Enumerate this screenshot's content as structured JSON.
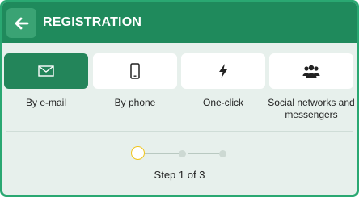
{
  "header": {
    "title": "REGISTRATION",
    "back_icon": "arrow-left-icon",
    "color": "#1f8a5c"
  },
  "tabs": [
    {
      "id": "email",
      "label": "By e-mail",
      "icon": "envelope-icon",
      "active": true
    },
    {
      "id": "phone",
      "label": "By phone",
      "icon": "smartphone-icon",
      "active": false
    },
    {
      "id": "oneclick",
      "label": "One-click",
      "icon": "lightning-icon",
      "active": false
    },
    {
      "id": "social",
      "label": "Social networks and messengers",
      "icon": "users-icon",
      "active": false
    }
  ],
  "steps": {
    "label": "Step 1 of 3",
    "current": 1,
    "total": 3,
    "current_color": "#f0c419"
  },
  "colors": {
    "accent": "#1f8a5c",
    "border": "#2aa872",
    "background": "#e7f0ec"
  }
}
